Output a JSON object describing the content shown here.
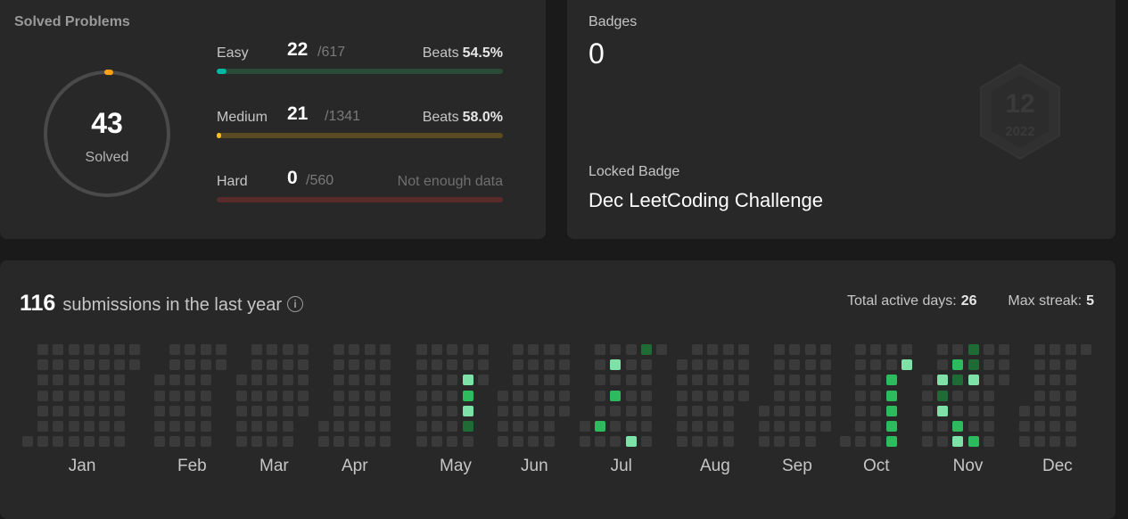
{
  "solved": {
    "title": "Solved Problems",
    "total": "43",
    "total_label": "Solved",
    "difficulties": [
      {
        "name": "Easy",
        "solved": "22",
        "total": "/617",
        "beats_label": "Beats",
        "beats": "54.5%",
        "fraction": 0.0357,
        "color": "#00b8a3",
        "track": "#2a4a36"
      },
      {
        "name": "Medium",
        "solved": "21",
        "total": "/1341",
        "beats_label": "Beats",
        "beats": "58.0%",
        "fraction": 0.0157,
        "color": "#ffc01e",
        "track": "#5a4a1f"
      },
      {
        "name": "Hard",
        "solved": "0",
        "total": "/560",
        "no_data": "Not enough data",
        "fraction": 0,
        "color": "#ef4743",
        "track": "#5a2a2a"
      }
    ],
    "ring_fraction": 0.017,
    "ring_color": "#ffa116",
    "ring_track": "#4a4a4a"
  },
  "badges": {
    "label": "Badges",
    "count": "0",
    "locked_label": "Locked Badge",
    "locked_name": "Dec LeetCoding Challenge",
    "badge_icon": "calendar-badge-icon",
    "badge_art_number": "12",
    "badge_art_year": "2022"
  },
  "submissions": {
    "count": "116",
    "text": "submissions in the last year",
    "active_days_label": "Total active days:",
    "active_days": "26",
    "max_streak_label": "Max streak:",
    "max_streak": "5",
    "months": [
      "Jan",
      "Feb",
      "Mar",
      "Apr",
      "May",
      "Jun",
      "Jul",
      "Aug",
      "Sep",
      "Oct",
      "Nov",
      "Dec"
    ],
    "colors": {
      "empty": "#3a3a3a",
      "l1": "#1e6b35",
      "l2": "#2cbb5d",
      "l3": "#7ee2a8"
    }
  }
}
